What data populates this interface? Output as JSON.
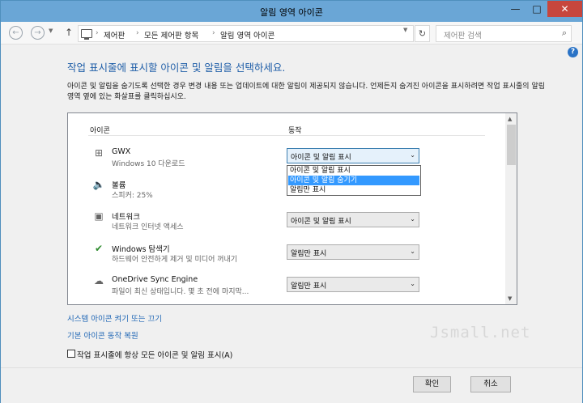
{
  "window": {
    "title": "알림 영역 아이콘",
    "controls": {
      "minimize": "—",
      "maximize": "□",
      "close": "✕"
    }
  },
  "address_bar": {
    "breadcrumbs": [
      "제어판",
      "모든 제어판 항목",
      "알림 영역 아이콘"
    ],
    "search_placeholder": "제어판 검색"
  },
  "main": {
    "heading": "작업 표시줄에 표시할 아이콘 및 알림을 선택하세요.",
    "description": "아이콘 및 알림을 숨기도록 선택한 경우 변경 내용 또는 업데이트에 대한 알림이 제공되지 않습니다. 언제든지 숨겨진 아이콘을 표시하려면 작업 표시줄의 알림 영역 옆에 있는 화살표를 클릭하십시오.",
    "columns": {
      "icon": "아이콘",
      "behavior": "동작"
    },
    "rows": [
      {
        "icon": "windows-logo",
        "name": "GWX",
        "sub": "Windows 10 다운로드",
        "behavior": "아이콘 및 알림 표시"
      },
      {
        "icon": "speaker",
        "name": "볼륨",
        "sub": "스피커: 25%",
        "behavior": ""
      },
      {
        "icon": "network",
        "name": "네트워크",
        "sub": "네트워크 인터넷 액세스",
        "behavior": "아이콘 및 알림 표시"
      },
      {
        "icon": "usb-safe-remove",
        "name": "Windows 탐색기",
        "sub": "하드웨어 안전하게 제거 및 미디어 꺼내기",
        "behavior": "알림만 표시"
      },
      {
        "icon": "onedrive-cloud",
        "name": "OneDrive Sync Engine",
        "sub": "파일이 최신 상태입니다. 몇 초 전에 마지막...",
        "behavior": "알림만 표시"
      }
    ],
    "dropdown_options": [
      "아이콘 및 알림 표시",
      "아이콘 및 알림 숨기기",
      "알림만 표시"
    ],
    "dropdown_highlighted": "아이콘 및 알림 숨기기",
    "links": {
      "system_icons": "시스템 아이콘 켜기 또는 끄기",
      "restore_defaults": "기본 아이콘 동작 복원"
    },
    "always_show_label": "작업 표시줄에 항상 모든 아이콘 및 알림 표시(A)",
    "always_show_checked": false,
    "watermark": "Jsmall.net"
  },
  "buttons": {
    "ok": "확인",
    "cancel": "취소"
  },
  "colors": {
    "titlebar": "#6aa6d6",
    "close_button": "#c7463d",
    "link": "#1f66b5",
    "heading": "#1f5ea8",
    "selection": "#3399ff"
  }
}
